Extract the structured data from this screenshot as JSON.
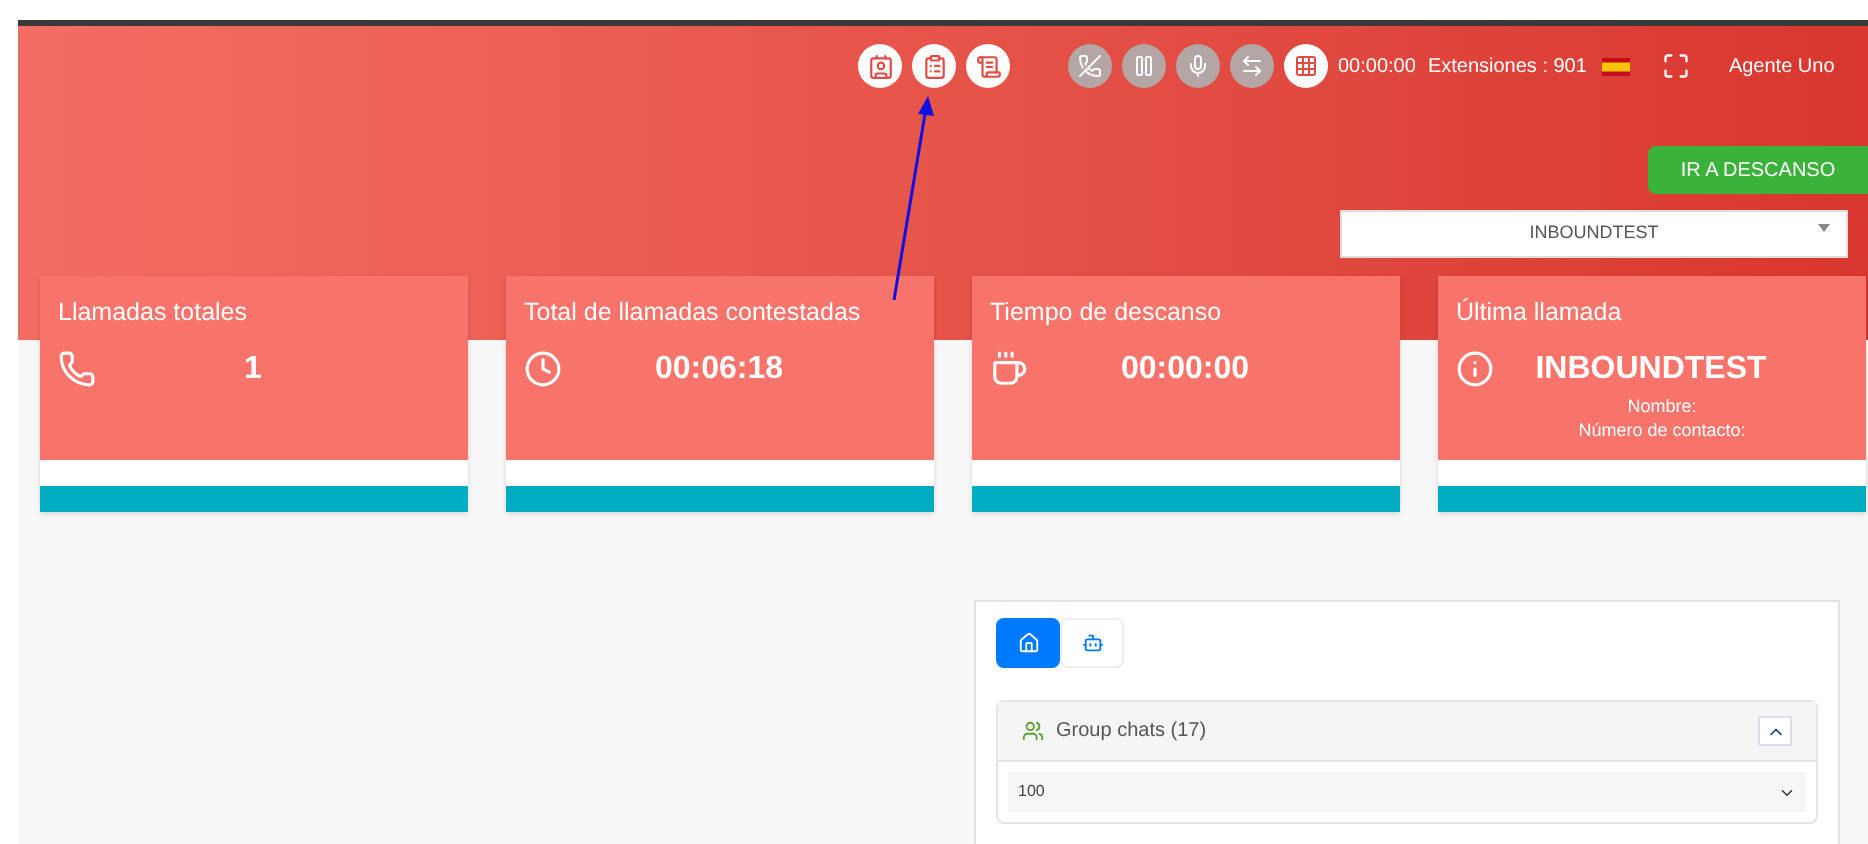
{
  "header": {
    "agent_tools": [
      {
        "kind": "contacts"
      },
      {
        "kind": "form"
      },
      {
        "kind": "script"
      }
    ],
    "call_controls": [
      {
        "kind": "hangup",
        "disabled": true
      },
      {
        "kind": "hold",
        "disabled": true
      },
      {
        "kind": "mute",
        "disabled": true
      },
      {
        "kind": "transfer",
        "disabled": true
      },
      {
        "kind": "keypad",
        "disabled": false
      }
    ],
    "timer": "00:00:00",
    "extension": "Extensiones : 901",
    "agent": "Agente Uno"
  },
  "break_button": "IR A DESCANSO",
  "campaign_select": {
    "value": "INBOUNDTEST"
  },
  "cards": [
    {
      "kind": "phone",
      "title": "Llamadas totales",
      "value": "1"
    },
    {
      "kind": "clock",
      "title": "Total de llamadas contestadas",
      "value": "00:06:18"
    },
    {
      "kind": "coffee",
      "title": "Tiempo de descanso",
      "value": "00:00:00"
    },
    {
      "kind": "info",
      "title": "Última llamada",
      "value": "INBOUNDTEST",
      "details": [
        "Nombre:",
        "Número de contacto:"
      ]
    }
  ],
  "chat": {
    "tabs": [
      {
        "kind": "home",
        "selected": true
      },
      {
        "kind": "bot",
        "selected": false
      }
    ],
    "section": {
      "title": "Group chats (17)",
      "expanded": true
    },
    "page_size": "100"
  }
}
